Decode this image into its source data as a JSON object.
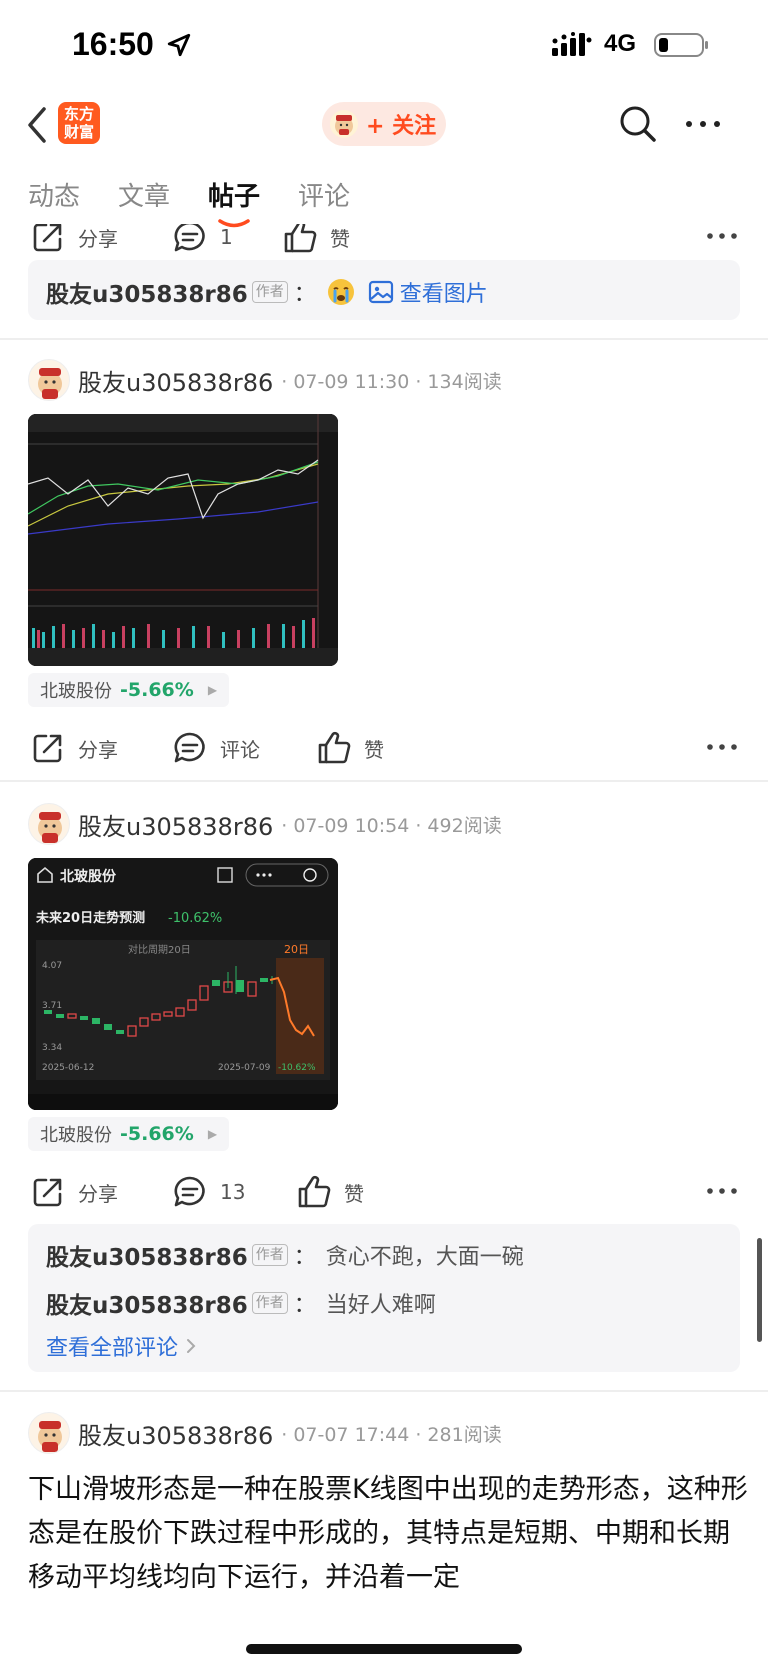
{
  "status_bar": {
    "time": "16:50",
    "network": "4G"
  },
  "nav": {
    "logo_text": "东方\n财富",
    "follow_label": "+ 关注"
  },
  "tabs": [
    "动态",
    "文章",
    "帖子",
    "评论"
  ],
  "active_tab": "帖子",
  "post0": {
    "actions": {
      "share": "分享",
      "comment": "1",
      "like": "赞"
    },
    "comment": {
      "user": "股友u305838r86",
      "tag": "作者",
      "colon": "：",
      "link": "查看图片"
    }
  },
  "post1": {
    "user": "股友u305838r86",
    "meta": "· 07-09 11:30 · 134阅读",
    "stock": {
      "name": "北玻股份",
      "change": "-5.66%"
    },
    "actions": {
      "share": "分享",
      "comment": "评论",
      "like": "赞"
    }
  },
  "post2": {
    "user": "股友u305838r86",
    "meta": "· 07-09 10:54 · 492阅读",
    "image": {
      "title": "北玻股份",
      "forecast_label": "未来20日走势预测",
      "forecast_value": "-10.62%",
      "compare_label": "对比周期20日",
      "days_label": "20日",
      "y_ticks": [
        "4.07",
        "3.71",
        "3.34"
      ],
      "date_start": "2025-06-12",
      "date_end": "2025-07-09",
      "end_pct": "-10.62%"
    },
    "stock": {
      "name": "北玻股份",
      "change": "-5.66%"
    },
    "actions": {
      "share": "分享",
      "comment": "13",
      "like": "赞"
    },
    "comments": [
      {
        "user": "股友u305838r86",
        "tag": "作者",
        "colon": "：",
        "text": "贪心不跑，大面一碗"
      },
      {
        "user": "股友u305838r86",
        "tag": "作者",
        "colon": "：",
        "text": "当好人难啊"
      }
    ],
    "view_all": "查看全部评论"
  },
  "post3": {
    "user": "股友u305838r86",
    "meta": "· 07-07 17:44 · 281阅读",
    "text": "下山滑坡形态是一种在股票K线图中出现的走势形态，这种形态是在股价下跌过程中形成的，其特点是短期、中期和长期移动平均线均向下运行，并沿着一定"
  },
  "colors": {
    "accent": "#ff4b1f",
    "link": "#2f6fd8",
    "down": "#22a56a",
    "up": "#e64343"
  }
}
